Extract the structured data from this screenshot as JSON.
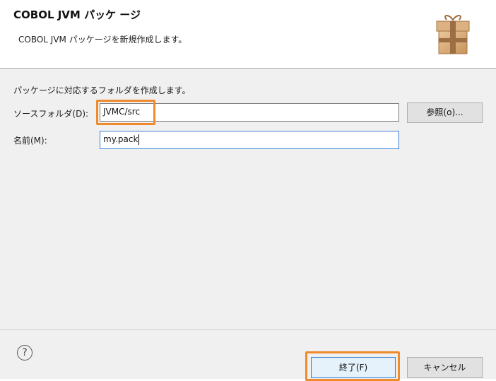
{
  "header": {
    "title": "COBOL JVM パッケ ージ",
    "subtitle": "COBOL JVM パッケージを新規作成します。",
    "icon": "package-icon"
  },
  "form": {
    "description": "パッケージに対応するフォルダを作成します。",
    "source_folder_label": "ソースフォルダ(D):",
    "source_folder_value": "JVMC/src",
    "browse_label": "参照(o)...",
    "name_label": "名前(M):",
    "name_value": "my.pack"
  },
  "footer": {
    "help_symbol": "?",
    "finish_label": "終了(F)",
    "cancel_label": "キャンセル"
  },
  "colors": {
    "highlight": "#ef8b2c",
    "focus_border": "#3c7fd6"
  }
}
